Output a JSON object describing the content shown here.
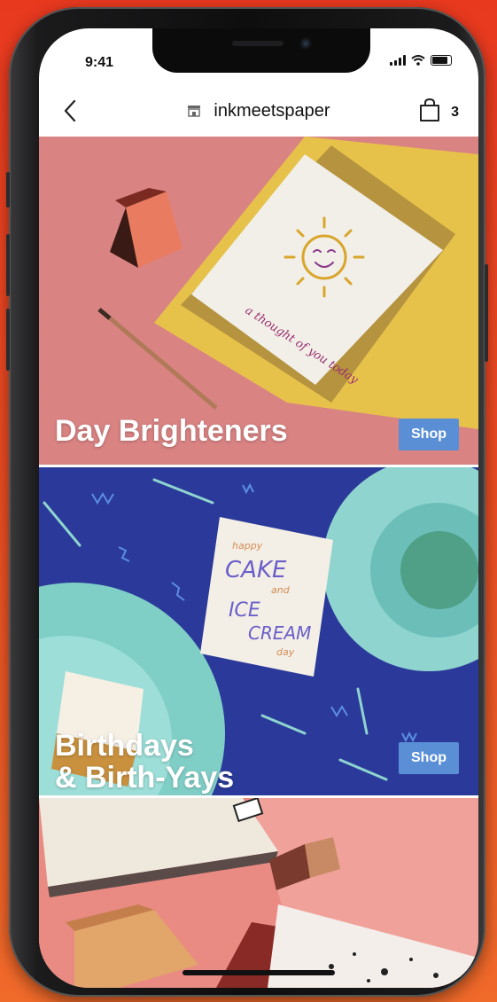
{
  "status": {
    "time": "9:41"
  },
  "nav": {
    "shop_name": "inkmeetspaper",
    "cart_count": "3"
  },
  "collections": [
    {
      "title": "Day Brighteners",
      "button": "Shop",
      "card_text": "a thought of you today"
    },
    {
      "title": "Birthdays\n& Birth-Yays",
      "button": "Shop",
      "card_text": [
        "happy",
        "CAKE",
        "and",
        "ICE",
        "CREAM",
        "day"
      ]
    }
  ],
  "colors": {
    "background": "#ec4b22",
    "shop_button": "#5a8fd6",
    "banner1": "#d88080",
    "banner2": "#2a3a99",
    "banner3": "#e68c84"
  },
  "icons": {
    "back": "chevron-left-icon",
    "shop": "storefront-icon",
    "cart": "shopping-bag-icon"
  }
}
